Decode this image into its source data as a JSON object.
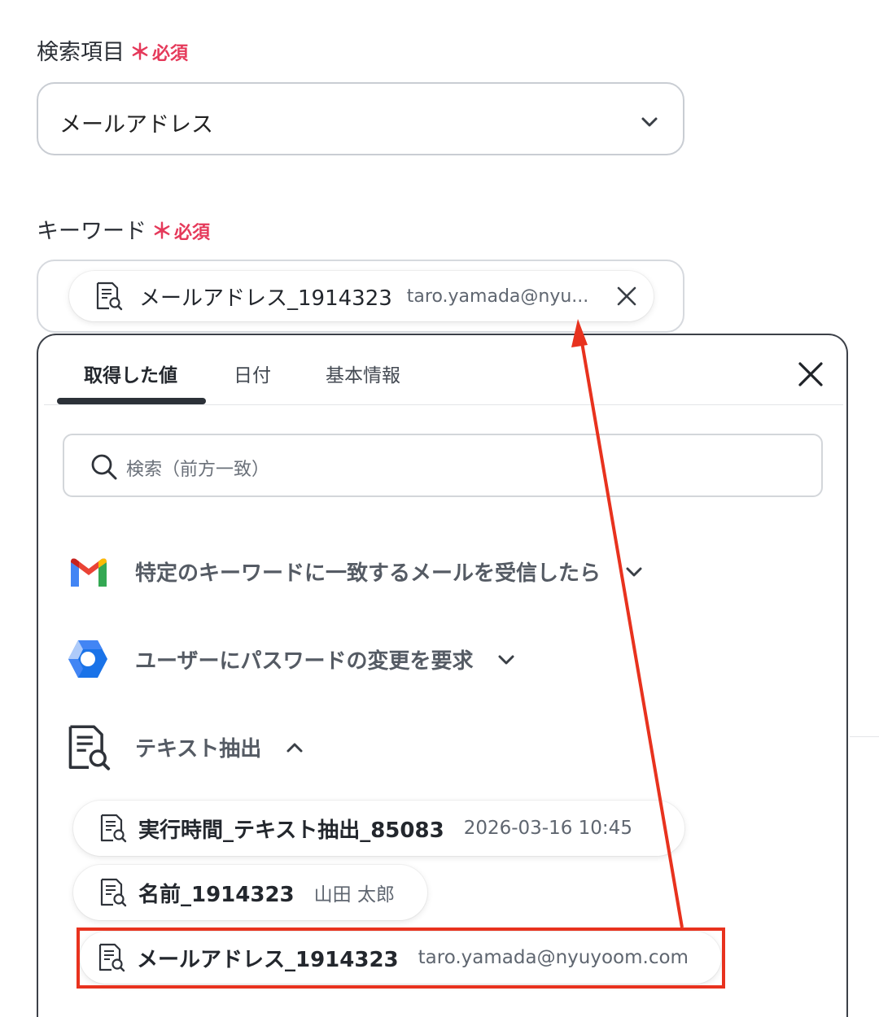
{
  "search_field": {
    "label": "検索項目",
    "required_mark": "＊",
    "required_text": "必須",
    "value": "メールアドレス"
  },
  "keyword_field": {
    "label": "キーワード",
    "required_mark": "＊",
    "required_text": "必須",
    "chip": {
      "name": "メールアドレス_1914323",
      "value": "taro.yamada@nyu..."
    }
  },
  "panel": {
    "tabs": [
      {
        "label": "取得した値",
        "active": true
      },
      {
        "label": "日付",
        "active": false
      },
      {
        "label": "基本情報",
        "active": false
      }
    ],
    "search_placeholder": "検索（前方一致）",
    "groups": [
      {
        "title": "特定のキーワードに一致するメールを受信したら",
        "icon": "gmail-icon",
        "expanded": false
      },
      {
        "title": "ユーザーにパスワードの変更を要求",
        "icon": "google-workspace-icon",
        "expanded": false
      },
      {
        "title": "テキスト抽出",
        "icon": "document-search-icon",
        "expanded": true
      }
    ],
    "items": [
      {
        "name": "実行時間_テキスト抽出_85083",
        "value": "2026-03-16 10:45"
      },
      {
        "name": "名前_1914323",
        "value": "山田 太郎"
      },
      {
        "name": "メールアドレス_1914323",
        "value": "taro.yamada@nyuyoom.com",
        "highlighted": true
      }
    ]
  },
  "colors": {
    "required": "#e5395a",
    "highlight": "#e8321e",
    "gmail_red": "#ea4335",
    "gmail_blue": "#4285f4",
    "gmail_green": "#34a853",
    "gmail_yellow": "#fbbc04",
    "workspace_blue": "#1a73e8"
  }
}
